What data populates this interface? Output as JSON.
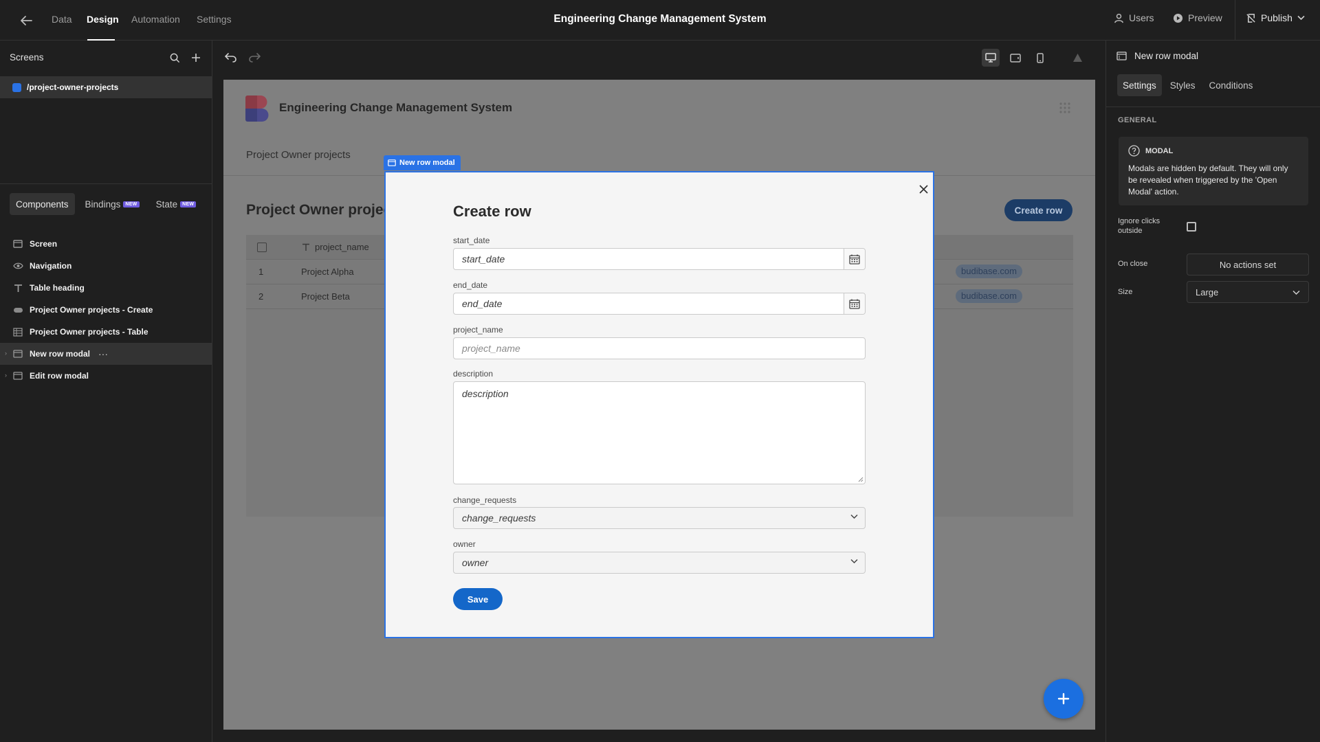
{
  "nav": {
    "tabs": [
      {
        "label": "Data"
      },
      {
        "label": "Design"
      },
      {
        "label": "Automation"
      },
      {
        "label": "Settings"
      }
    ],
    "app_title": "Engineering Change Management System",
    "users": "Users",
    "preview": "Preview",
    "publish": "Publish"
  },
  "left_panel": {
    "screens_header": "Screens",
    "screen_route": "/project-owner-projects",
    "tabs": {
      "components": "Components",
      "bindings": "Bindings",
      "state": "State",
      "new_badge": "NEW"
    },
    "tree": [
      {
        "label": "Screen",
        "icon": "screen-icon"
      },
      {
        "label": "Navigation",
        "icon": "eye-icon"
      },
      {
        "label": "Table heading",
        "icon": "text-icon"
      },
      {
        "label": "Project Owner projects - Create",
        "icon": "button-icon"
      },
      {
        "label": "Project Owner projects - Table",
        "icon": "table-icon"
      },
      {
        "label": "New row modal",
        "icon": "modal-icon",
        "selected": true
      },
      {
        "label": "Edit row modal",
        "icon": "modal-icon"
      }
    ]
  },
  "canvas": {
    "site_title": "Engineering Change Management System",
    "breadcrumb": "Project Owner projects",
    "heading": "Project Owner projec",
    "create_button": "Create row",
    "table": {
      "column": "project_name",
      "rows": [
        {
          "index": "1",
          "name": "Project Alpha",
          "chip": "budibase.com"
        },
        {
          "index": "2",
          "name": "Project Beta",
          "chip": "budibase.com"
        }
      ]
    },
    "fab": "+"
  },
  "modal": {
    "tag": "New row modal",
    "title": "Create row",
    "fields": [
      {
        "label": "start_date",
        "placeholder": "start_date"
      },
      {
        "label": "end_date",
        "placeholder": "end_date"
      },
      {
        "label": "project_name",
        "placeholder": "project_name"
      },
      {
        "label": "description",
        "placeholder": "description"
      },
      {
        "label": "change_requests",
        "placeholder": "change_requests"
      },
      {
        "label": "owner",
        "placeholder": "owner"
      }
    ],
    "save": "Save"
  },
  "right_panel": {
    "title": "New row modal",
    "tabs": [
      {
        "label": "Settings"
      },
      {
        "label": "Styles"
      },
      {
        "label": "Conditions"
      }
    ],
    "section": "GENERAL",
    "info_title": "MODAL",
    "info_text": "Modals are hidden by default. They will only be revealed when triggered by the 'Open Modal' action.",
    "ignore_clicks_label": "Ignore clicks outside",
    "on_close_label": "On close",
    "on_close_value": "No actions set",
    "size_label": "Size",
    "size_value": "Large"
  },
  "colors": {
    "accent": "#2a72e5",
    "save_button": "#1467c9",
    "logo_red": "#c63b4a",
    "logo_blue": "#5153b8"
  }
}
